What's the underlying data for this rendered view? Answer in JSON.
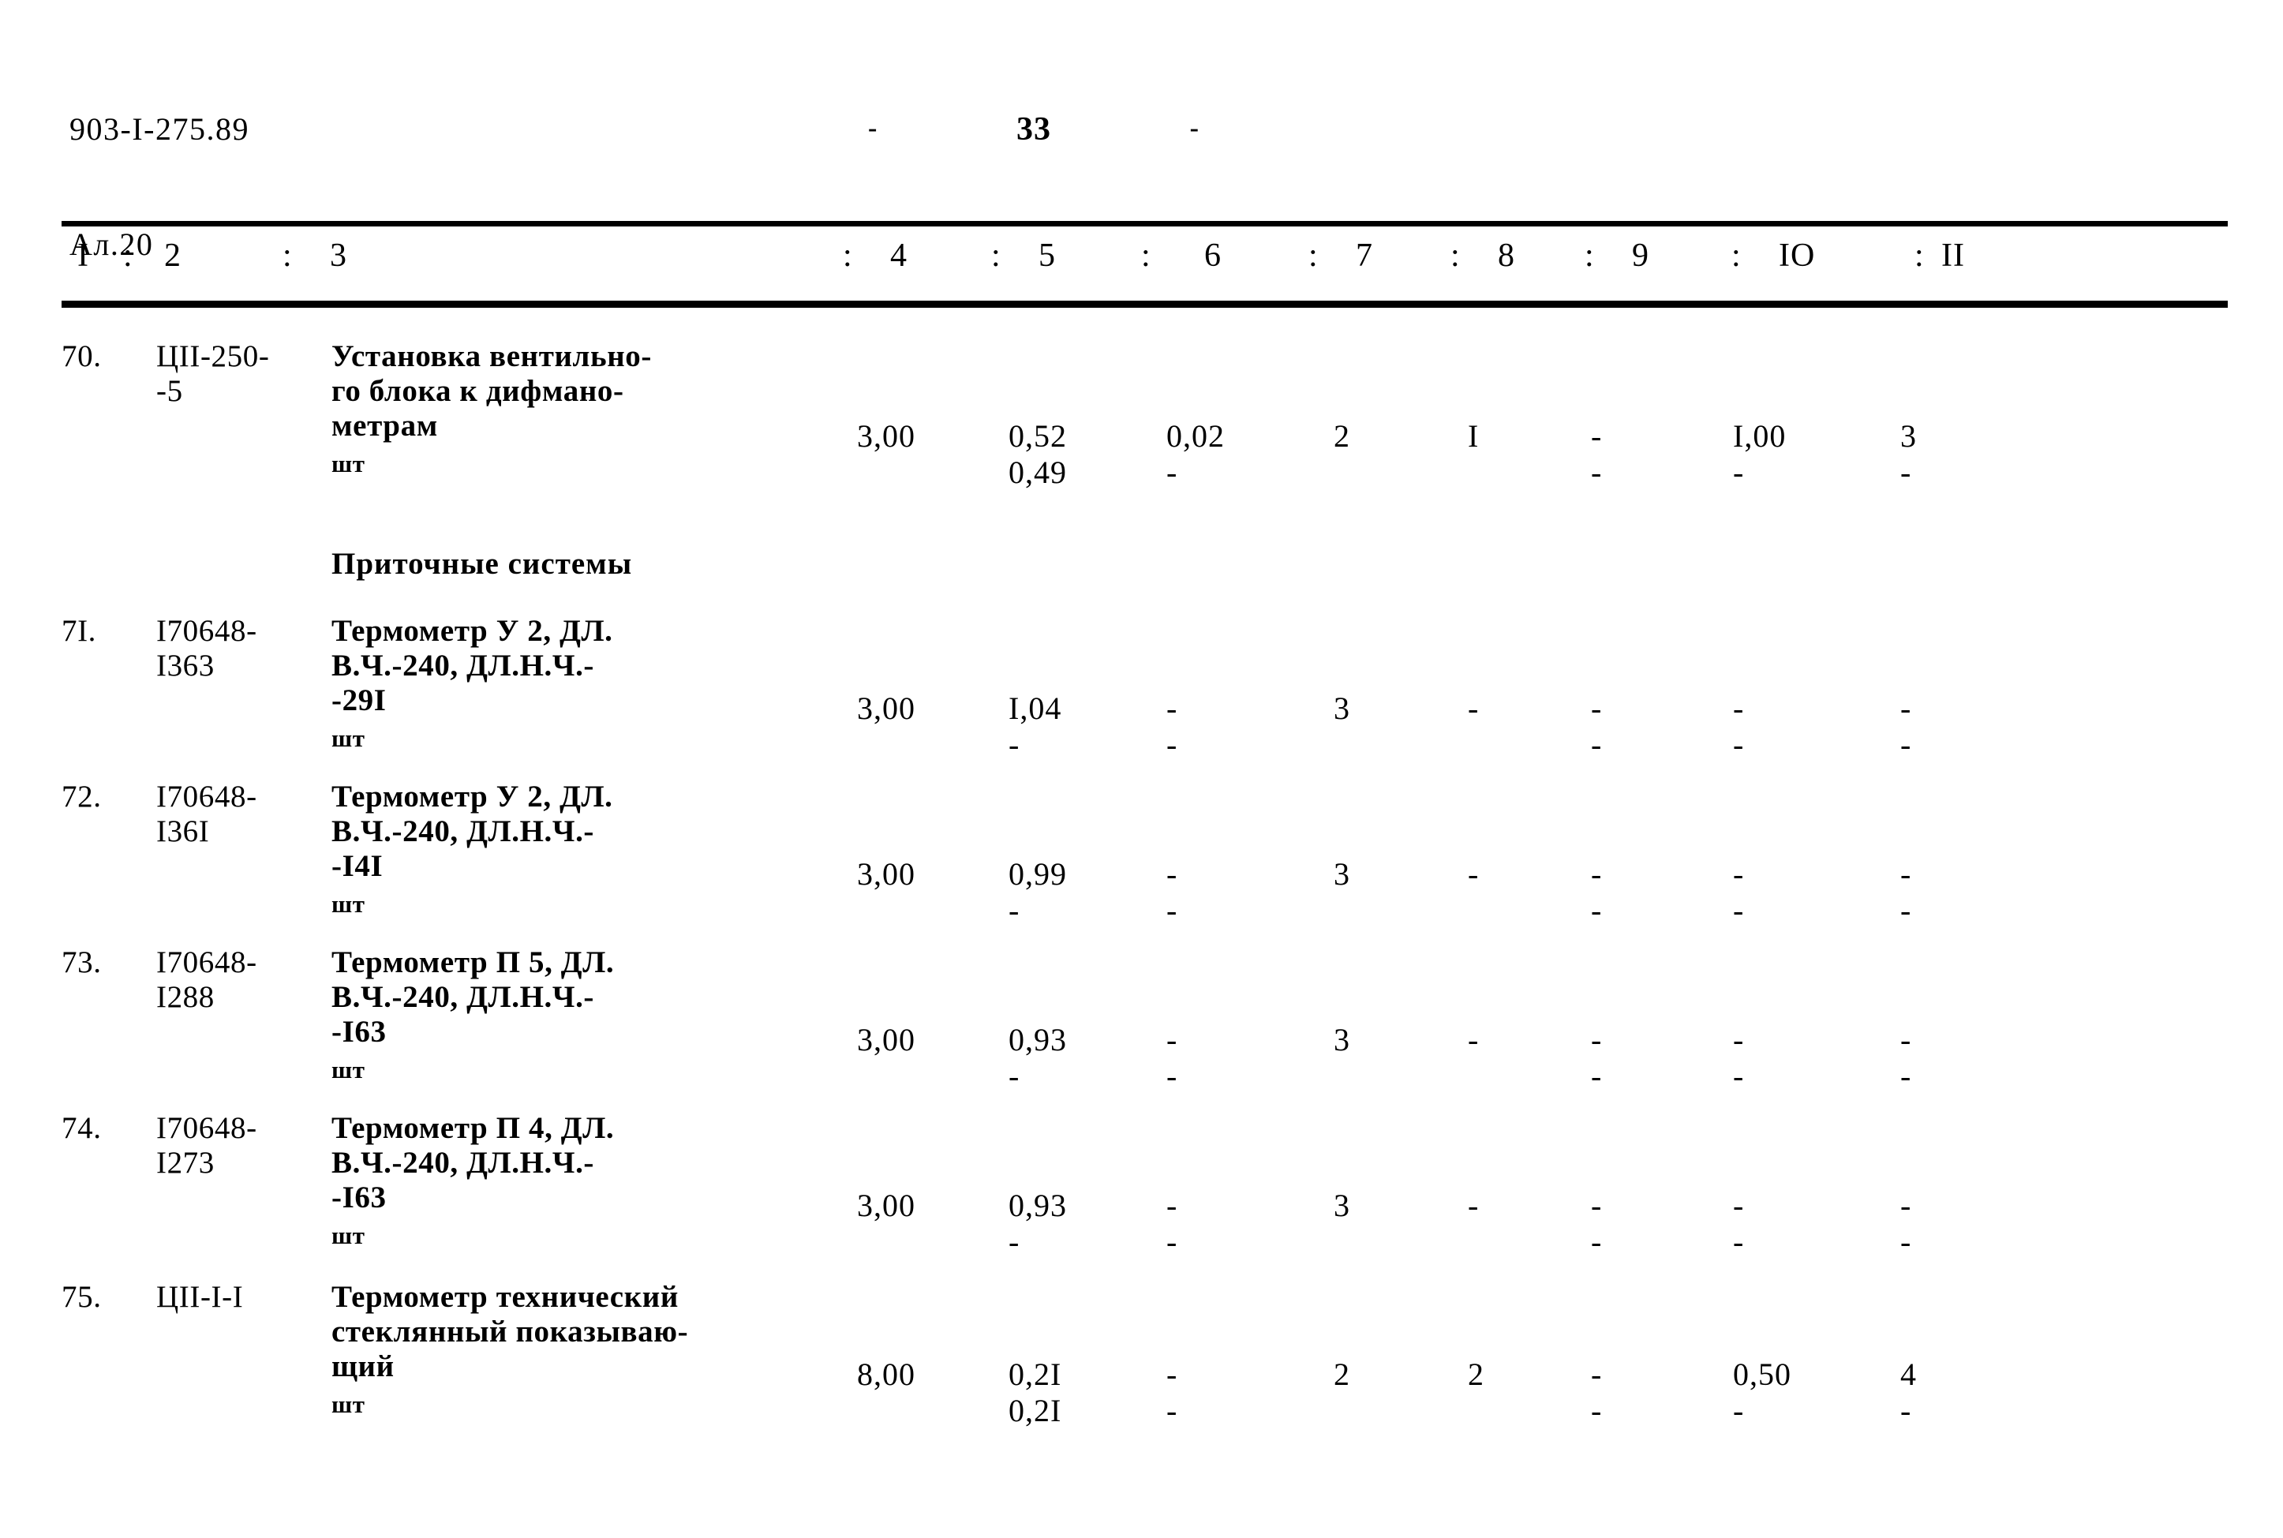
{
  "header": {
    "doc_code": "903-I-275.89",
    "sheet": "Ал.20",
    "page_dash_left": "-",
    "page_number": "33",
    "page_dash_right": "-"
  },
  "table": {
    "column_headers": [
      {
        "label": "I",
        "sep": ""
      },
      {
        "label": "2",
        "sep": ":"
      },
      {
        "label": "3",
        "sep": ":"
      },
      {
        "label": "4",
        "sep": ":"
      },
      {
        "label": "5",
        "sep": ":"
      },
      {
        "label": "6",
        "sep": ":"
      },
      {
        "label": "7",
        "sep": ":"
      },
      {
        "label": "8",
        "sep": ":"
      },
      {
        "label": "9",
        "sep": ":"
      },
      {
        "label": "IO",
        "sep": ":"
      },
      {
        "label": "II",
        "sep": ":"
      }
    ],
    "rows": [
      {
        "num": "70.",
        "code_lines": [
          "ЦII-250-",
          "-5"
        ],
        "desc_lines": [
          "Установка вентильно-",
          "го блока к дифмано-",
          "метрам"
        ],
        "unit": "шт",
        "c4": "3,00",
        "c5_top": "0,52",
        "c5_bot": "0,49",
        "c6_top": "0,02",
        "c6_bot": "-",
        "c7_top": "2",
        "c7_bot": "",
        "c8_top": "I",
        "c8_bot": "",
        "c9_top": "-",
        "c9_bot": "-",
        "c10_top": "I,00",
        "c10_bot": "-",
        "c11_top": "3",
        "c11_bot": "-"
      },
      {
        "num": "7I.",
        "code_lines": [
          "I70648-",
          "I363"
        ],
        "desc_lines": [
          "Термометр У 2, ДЛ.",
          "В.Ч.-240, ДЛ.Н.Ч.-",
          "-29I"
        ],
        "unit": "шт",
        "c4": "3,00",
        "c5_top": "I,04",
        "c5_bot": "-",
        "c6_top": "-",
        "c6_bot": "-",
        "c7_top": "3",
        "c7_bot": "",
        "c8_top": "-",
        "c8_bot": "",
        "c9_top": "-",
        "c9_bot": "-",
        "c10_top": "-",
        "c10_bot": "-",
        "c11_top": "-",
        "c11_bot": "-"
      },
      {
        "num": "72.",
        "code_lines": [
          "I70648-",
          "I36I"
        ],
        "desc_lines": [
          "Термометр У 2, ДЛ.",
          "В.Ч.-240, ДЛ.Н.Ч.-",
          "-I4I"
        ],
        "unit": "шт",
        "c4": "3,00",
        "c5_top": "0,99",
        "c5_bot": "-",
        "c6_top": "-",
        "c6_bot": "-",
        "c7_top": "3",
        "c7_bot": "",
        "c8_top": "-",
        "c8_bot": "",
        "c9_top": "-",
        "c9_bot": "-",
        "c10_top": "-",
        "c10_bot": "-",
        "c11_top": "-",
        "c11_bot": "-"
      },
      {
        "num": "73.",
        "code_lines": [
          "I70648-",
          "I288"
        ],
        "desc_lines": [
          "Термометр П 5, ДЛ.",
          "В.Ч.-240, ДЛ.Н.Ч.-",
          "-I63"
        ],
        "unit": "шт",
        "c4": "3,00",
        "c5_top": "0,93",
        "c5_bot": "-",
        "c6_top": "-",
        "c6_bot": "-",
        "c7_top": "3",
        "c7_bot": "",
        "c8_top": "-",
        "c8_bot": "",
        "c9_top": "-",
        "c9_bot": "-",
        "c10_top": "-",
        "c10_bot": "-",
        "c11_top": "-",
        "c11_bot": "-"
      },
      {
        "num": "74.",
        "code_lines": [
          "I70648-",
          "I273"
        ],
        "desc_lines": [
          "Термометр П 4, ДЛ.",
          "В.Ч.-240, ДЛ.Н.Ч.-",
          "-I63"
        ],
        "unit": "шт",
        "c4": "3,00",
        "c5_top": "0,93",
        "c5_bot": "-",
        "c6_top": "-",
        "c6_bot": "-",
        "c7_top": "3",
        "c7_bot": "",
        "c8_top": "-",
        "c8_bot": "",
        "c9_top": "-",
        "c9_bot": "-",
        "c10_top": "-",
        "c10_bot": "-",
        "c11_top": "-",
        "c11_bot": "-"
      },
      {
        "num": "75.",
        "code_lines": [
          "ЦII-I-I"
        ],
        "desc_lines": [
          "Термометр технический",
          "стеклянный показываю-",
          "щий"
        ],
        "unit": "шт",
        "c4": "8,00",
        "c5_top": "0,2I",
        "c5_bot": "0,2I",
        "c6_top": "-",
        "c6_bot": "-",
        "c7_top": "2",
        "c7_bot": "",
        "c8_top": "2",
        "c8_bot": "",
        "c9_top": "-",
        "c9_bot": "-",
        "c10_top": "0,50",
        "c10_bot": "-",
        "c11_top": "4",
        "c11_bot": "-"
      }
    ],
    "section_heading": "Приточные системы"
  }
}
